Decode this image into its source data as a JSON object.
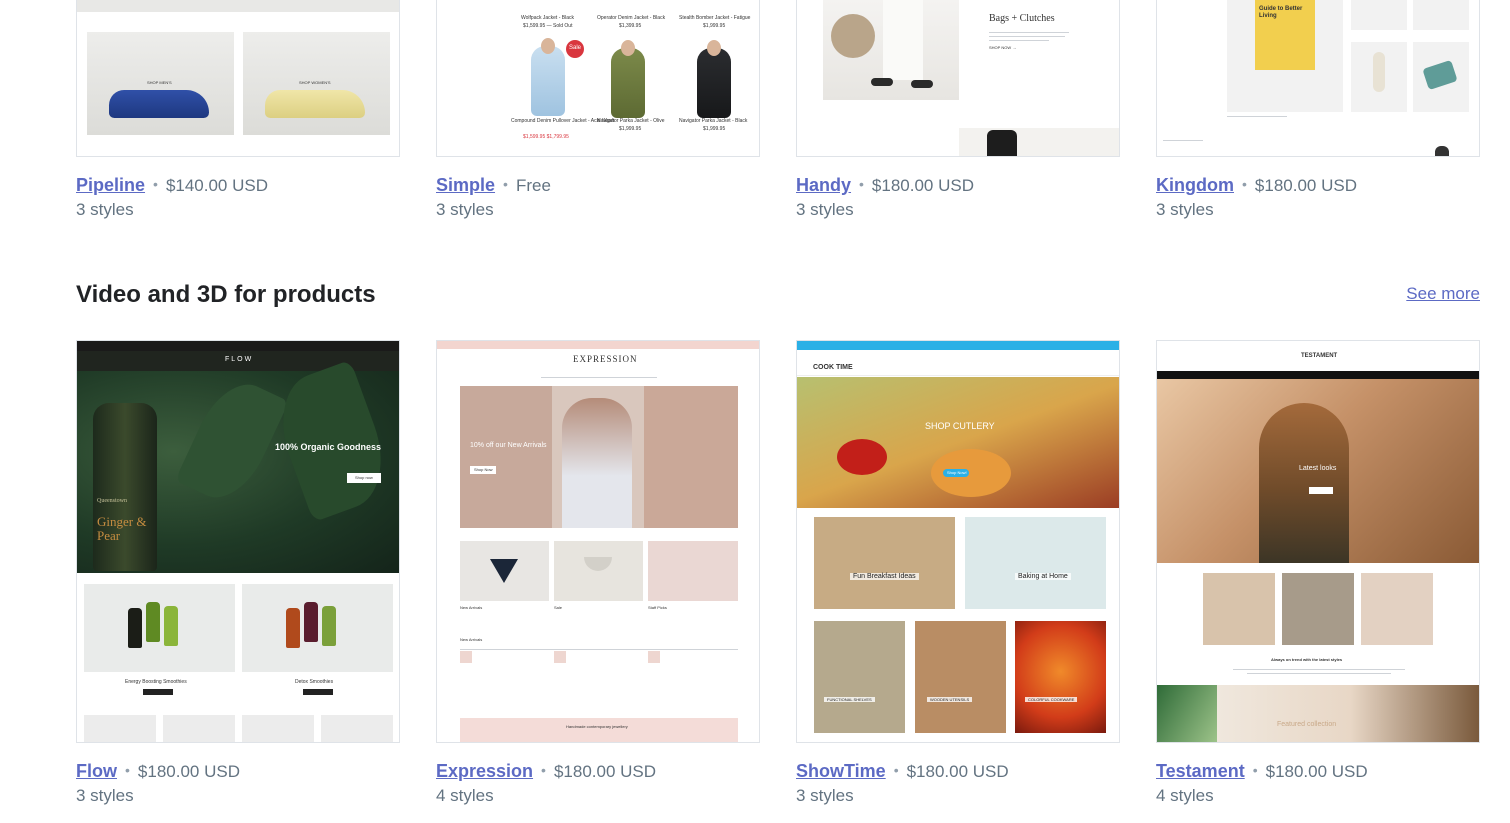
{
  "top_row": [
    {
      "name": "Pipeline",
      "price": "$140.00 USD",
      "styles": "3 styles",
      "thumb_text": [
        "SHOP MEN'S",
        "SHOP WOMEN'S"
      ]
    },
    {
      "name": "Simple",
      "price": "Free",
      "styles": "3 styles",
      "thumb_text": [
        "Wolfpack Jacket - Black",
        "Operator Denim Jacket - Black",
        "Stealth Bomber Jacket - Fatigue",
        "$1,599.95 — Sold Out",
        "$1,399.95",
        "$1,999.95",
        "Sale",
        "Compound Denim Pullover Jacket - Acid Wash",
        "Navigator Parka Jacket - Olive",
        "Navigator Parka Jacket - Black",
        "$1,599.95 $1,799.95",
        "$1,999.95",
        "$1,999.95"
      ]
    },
    {
      "name": "Handy",
      "price": "$180.00 USD",
      "styles": "3 styles",
      "thumb_text": [
        "Bags + Clutches",
        "SHOP NOW →"
      ]
    },
    {
      "name": "Kingdom",
      "price": "$180.00 USD",
      "styles": "3 styles",
      "thumb_text": [
        "Guide to Better Living"
      ]
    }
  ],
  "section": {
    "title": "Video and 3D for products",
    "see_more": "See more"
  },
  "bottom_row": [
    {
      "name": "Flow",
      "price": "$180.00 USD",
      "styles": "3 styles",
      "thumb_text": [
        "FLOW",
        "100% Organic Goodness",
        "Shop now",
        "Queenstown",
        "Ginger & Pear",
        "Energy Boosting Smoothies",
        "Detox Smoothies"
      ]
    },
    {
      "name": "Expression",
      "price": "$180.00 USD",
      "styles": "4 styles",
      "thumb_text": [
        "EXPRESSION",
        "10% off our New Arrivals",
        "Shop Now",
        "New Arrivals",
        "Sale",
        "Staff Picks",
        "Handmade contemporary jewellery"
      ]
    },
    {
      "name": "ShowTime",
      "price": "$180.00 USD",
      "styles": "3 styles",
      "thumb_text": [
        "COOK TIME",
        "SHOP CUTLERY",
        "Shop Now!",
        "Fun Breakfast Ideas",
        "Baking at Home",
        "FUNCTIONAL SHELVES",
        "WOODEN UTENSILS",
        "COLORFUL COOKWARE"
      ]
    },
    {
      "name": "Testament",
      "price": "$180.00 USD",
      "styles": "4 styles",
      "thumb_text": [
        "TESTAMENT",
        "Latest looks",
        "Always on trend with the latest styles",
        "Featured collection"
      ]
    }
  ],
  "colors": {
    "link": "#5c6ac4",
    "muted": "#637381",
    "heading": "#212326",
    "border": "#dfe3e8"
  },
  "separator": "•"
}
